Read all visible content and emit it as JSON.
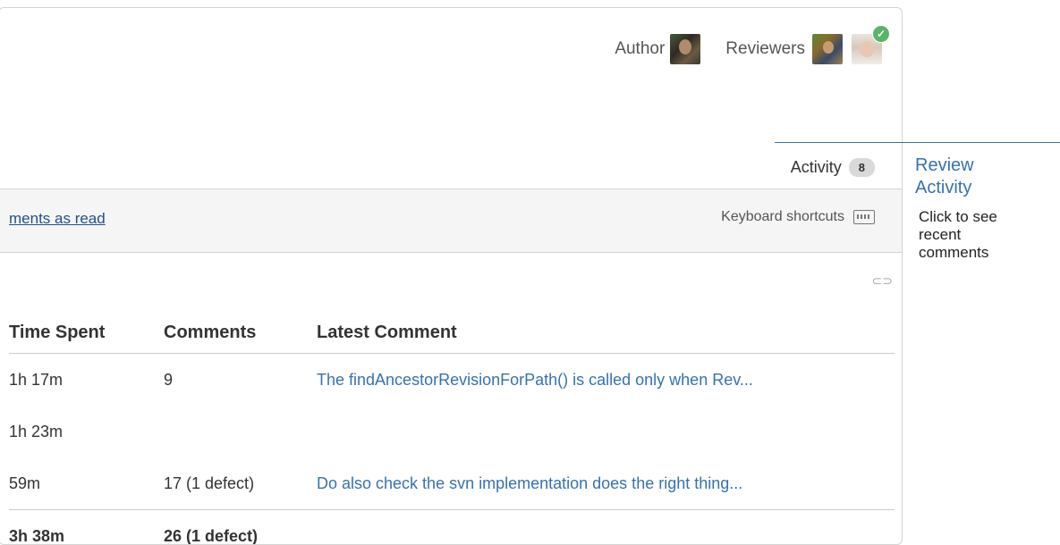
{
  "header": {
    "author_label": "Author",
    "reviewers_label": "Reviewers"
  },
  "tabs": {
    "activity_label": "Activity",
    "activity_count": "8"
  },
  "toolbar": {
    "mark_read": "ments as read",
    "keyboard_shortcuts": "Keyboard shortcuts"
  },
  "table": {
    "headers": [
      "Time Spent",
      "Comments",
      "Latest Comment"
    ],
    "rows": [
      {
        "time": "1h 17m",
        "comments": "9",
        "latest": "The findAncestorRevisionForPath() is called only when Rev..."
      },
      {
        "time": "1h 23m",
        "comments": "",
        "latest": ""
      },
      {
        "time": "59m",
        "comments": "17 (1 defect)",
        "latest": "Do also check the svn implementation does the right thing..."
      }
    ],
    "total": {
      "time": "3h 38m",
      "comments": "26 (1 defect)"
    }
  },
  "callout": {
    "title": "Review Activity",
    "text": "Click to see recent comments"
  },
  "colors": {
    "link": "#3572b0",
    "approved": "#59b368"
  }
}
